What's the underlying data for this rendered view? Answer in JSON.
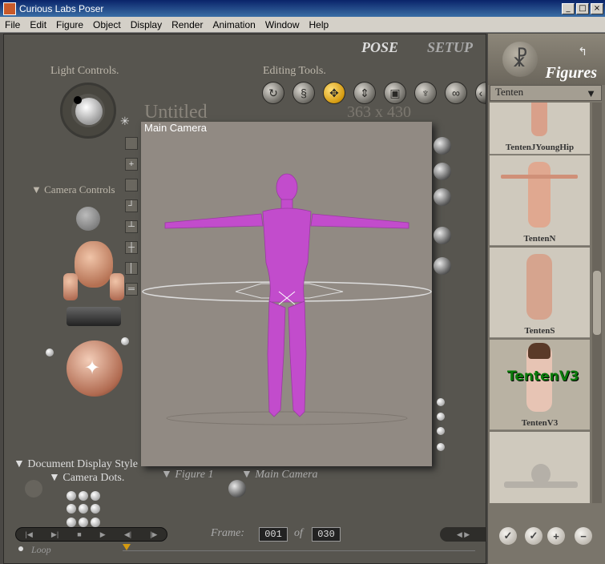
{
  "window": {
    "title": "Curious Labs Poser",
    "minimize": "_",
    "maximize": "□",
    "close": "×"
  },
  "menu": [
    "File",
    "Edit",
    "Figure",
    "Object",
    "Display",
    "Render",
    "Animation",
    "Window",
    "Help"
  ],
  "tabs": {
    "pose": "POSE",
    "setup": "SETUP"
  },
  "panels": {
    "light": "Light Controls.",
    "editing": "Editing Tools.",
    "camera_controls": "Camera Controls",
    "doc_style": "Document Display Style",
    "camera_dots": "Camera Dots.",
    "figure_sel": "Figure 1",
    "camera_sel": "Main Camera"
  },
  "document": {
    "title": "Untitled",
    "size": "363 x 430",
    "camera_label": "Main Camera"
  },
  "tools": [
    "rotate-icon",
    "twist-icon",
    "translate-icon",
    "translate-in-out-icon",
    "scale-icon",
    "taper-icon",
    "chain-break-icon"
  ],
  "timeline": {
    "frame_label": "Frame:",
    "frame": "001",
    "of": "of",
    "total": "030",
    "loop": "Loop"
  },
  "library": {
    "title": "Figures",
    "category": "Tenten",
    "items": [
      {
        "label": "TentenJYoungHip",
        "color": "#d9a08a"
      },
      {
        "label": "TentenN",
        "color": "#e0a890"
      },
      {
        "label": "TentenS",
        "color": "#d6a48e"
      },
      {
        "label": "TentenV3",
        "color": "#e7c4b4",
        "badge": "TentenV3"
      },
      {
        "label": "",
        "color": "#b5b0a8"
      }
    ]
  },
  "colors": {
    "figure": "#c24ccc",
    "accent": "#d49a10"
  }
}
